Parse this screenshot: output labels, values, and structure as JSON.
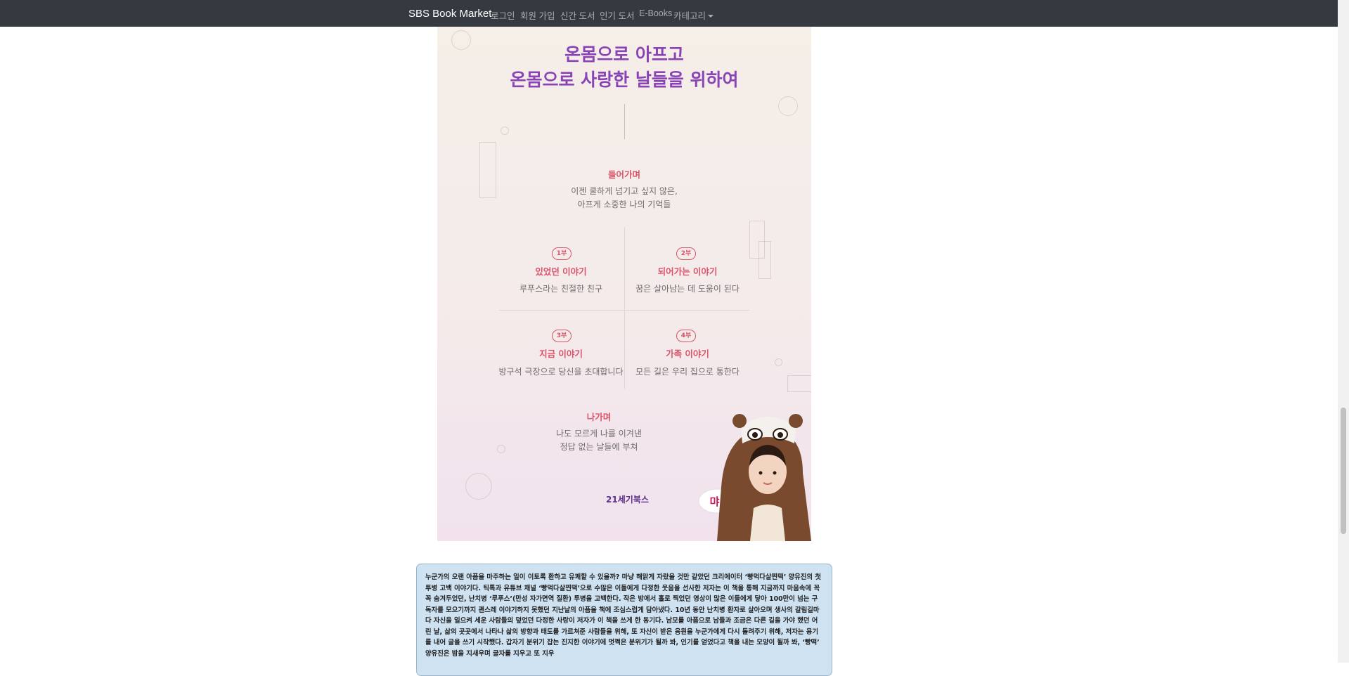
{
  "navbar": {
    "brand": "SBS Book Market",
    "links": [
      "로그인",
      "회원 가입",
      "신간 도서",
      "인기 도서",
      "E-Books",
      "카테고리"
    ]
  },
  "poster": {
    "title_line1": "온몸으로 아프고",
    "title_line2": "온몸으로 사랑한 날들을 위하여",
    "intro": {
      "title": "들어가며",
      "line1": "이젠 쿨하게 넘기고 싶지 않은,",
      "line2": "아프게 소중한 나의 기억들"
    },
    "parts": [
      {
        "badge": "1부",
        "title": "있었던 이야기",
        "text": "루푸스라는 친절한 친구"
      },
      {
        "badge": "2부",
        "title": "되어가는 이야기",
        "text": "꿈은 살아남는 데 도움이 된다"
      },
      {
        "badge": "3부",
        "title": "지금 이야기",
        "text": "방구석 극장으로 당신을 초대합니다"
      },
      {
        "badge": "4부",
        "title": "가족 이야기",
        "text": "모든 길은 우리 집으로 통한다"
      }
    ],
    "outro": {
      "title": "나가며",
      "line1": "나도 모르게 나를 이겨낸",
      "line2": "정답 없는 날들에 부쳐"
    },
    "bubble": "먀!",
    "publisher": "21세기북스"
  },
  "description": "누군가의 오랜 아픔을 마주하는 일이 이토록 환하고 유쾌할 수 있을까? 마냥 해맑게 자랐을 것만 같았던 크리에이터 ‘빵먹다살찐떡’ 양유진의 첫 투병 고백 이야기다. 틱톡과 유튜브 채널 ‘빵먹다살찐떡’으로 수많은 이들에게 다정한 웃음을 선사한 저자는 이 책을 통해 지금까지 마음속에 꼭꼭 숨겨두었던, 난치병 ‘루푸스’(만성 자가면역 질환) 투병을 고백한다. 작은 방에서 홀로 찍었던 영상이 많은 이들에게 닿아 100만이 넘는 구독자를 모으기까지 괜스레 이야기하지 못했던 지난날의 아픔을 책에 조심스럽게 담아냈다. 10년 동안 난치병 환자로 살아오며 생사의 갈림길마다 자신을 일으켜 세운 사람들의 덮었던 다정한 사랑이 저자가 이 책을 쓰게 한 동기다. 남모를 아픔으로 남들과 조금은 다른 길을 가야 했던 어린 날, 삶의 곳곳에서 나타나 삶의 방향과 태도를 가르쳐준 사람들을 위해, 또 자신이 받은 응원을 누군가에게 다시 돌려주기 위해, 저자는 용기를 내어 글을 쓰기 시작했다. 갑자기 분위기 잡는 진지한 이야기에 멋쩍은 분위기가 될까 봐, 인기를 얻었다고 책을 내는 모양이 될까 봐, ‘빵떡’ 양유진은 밤을 지새우며 글자를 지우고 또 지우"
}
